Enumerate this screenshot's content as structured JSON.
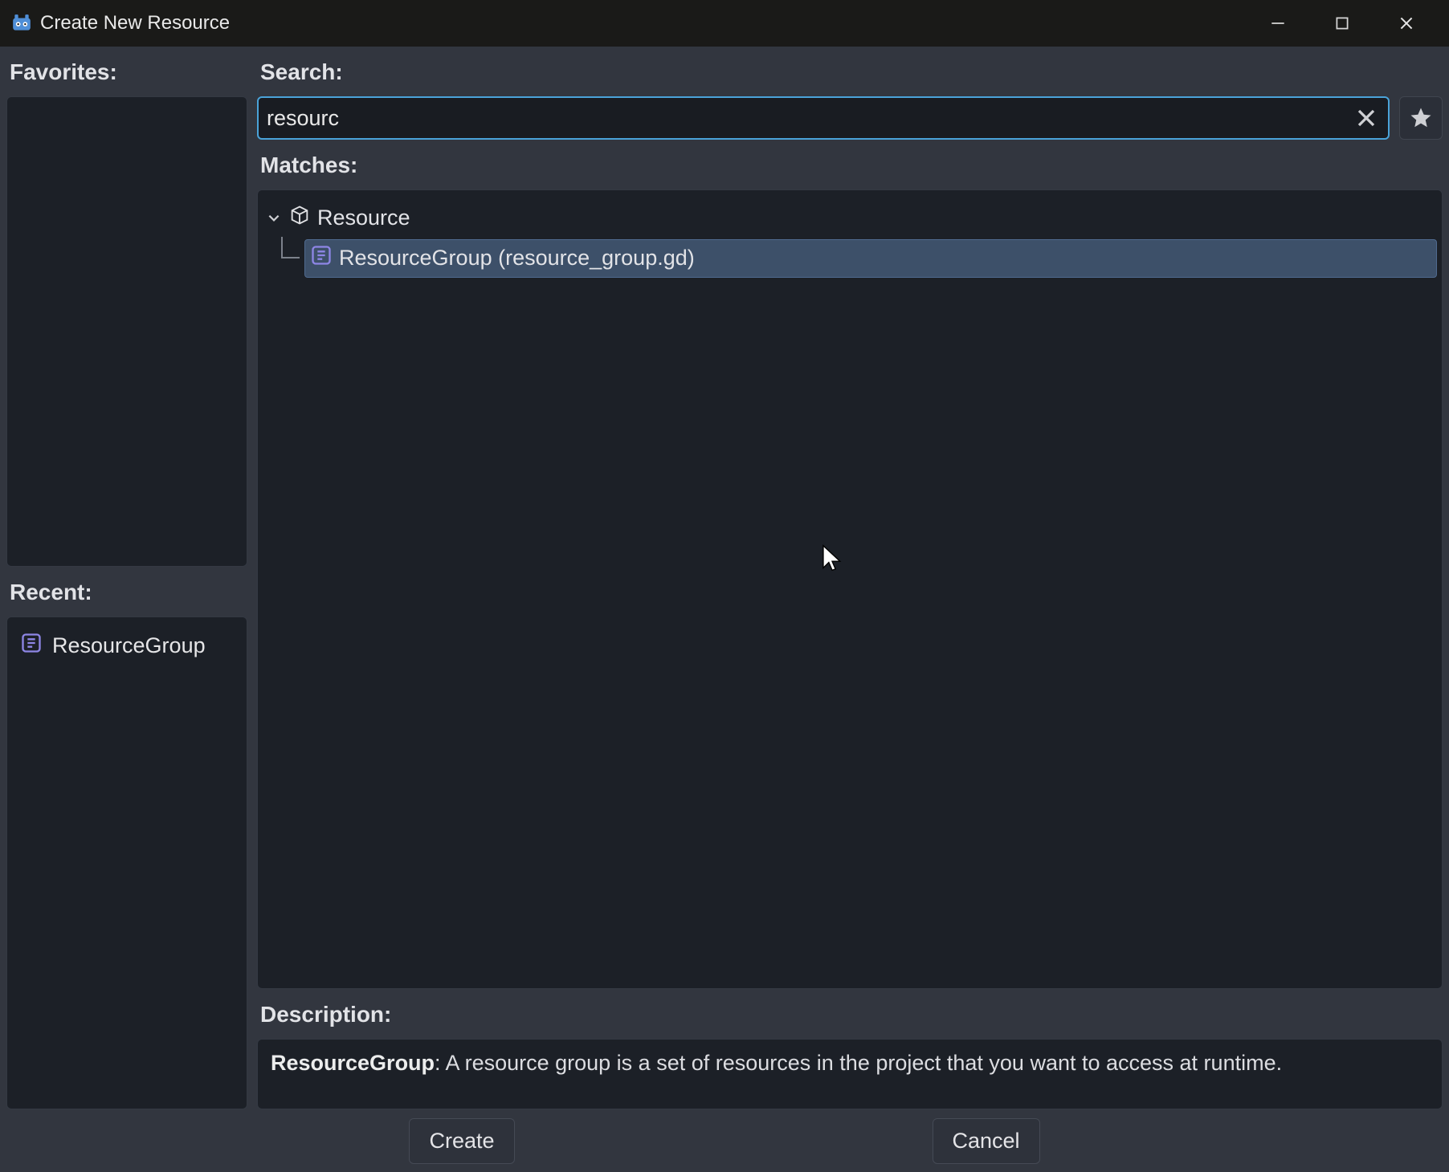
{
  "window": {
    "title": "Create New Resource"
  },
  "left": {
    "favorites_label": "Favorites:",
    "recent_label": "Recent:",
    "recent_items": [
      {
        "label": "ResourceGroup"
      }
    ]
  },
  "search": {
    "label": "Search:",
    "value": "resourc",
    "matches_label": "Matches:"
  },
  "matches": {
    "root": {
      "label": "Resource"
    },
    "children": [
      {
        "label": "ResourceGroup (resource_group.gd)",
        "selected": true
      }
    ]
  },
  "description": {
    "label": "Description:",
    "title": "ResourceGroup",
    "body": ": A resource group is a set of resources in the project that you want to access at runtime."
  },
  "buttons": {
    "create": "Create",
    "cancel": "Cancel"
  }
}
